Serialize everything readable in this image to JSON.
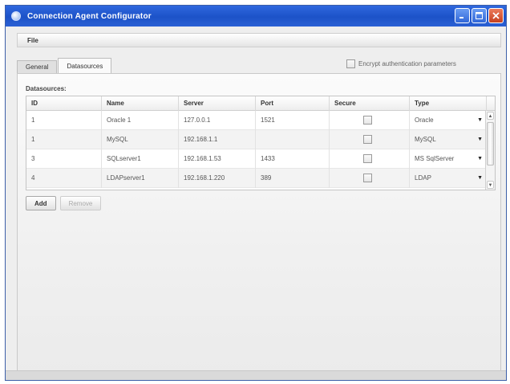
{
  "window": {
    "title": "Connection Agent Configurator"
  },
  "menu": {
    "items": [
      "File"
    ]
  },
  "tabs": [
    {
      "label": "General",
      "active": false
    },
    {
      "label": "Datasources",
      "active": true
    }
  ],
  "encrypt": {
    "label": "Encrypt authentication parameters",
    "checked": false
  },
  "datasources": {
    "section_label": "Datasources:",
    "columns": [
      "ID",
      "Name",
      "Server",
      "Port",
      "Secure",
      "Type"
    ],
    "rows": [
      {
        "id": "1",
        "name": "Oracle 1",
        "server": "127.0.0.1",
        "port": "1521",
        "secure": false,
        "type": "Oracle"
      },
      {
        "id": "1",
        "name": "MySQL",
        "server": "192.168.1.1",
        "port": "",
        "secure": false,
        "type": "MySQL"
      },
      {
        "id": "3",
        "name": "SQLserver1",
        "server": "192.168.1.53",
        "port": "1433",
        "secure": false,
        "type": "MS SqlServer"
      },
      {
        "id": "4",
        "name": "LDAPserver1",
        "server": "192.168.1.220",
        "port": "389",
        "secure": false,
        "type": "LDAP"
      }
    ]
  },
  "buttons": {
    "add": "Add",
    "remove": "Remove"
  },
  "colors": {
    "titlebar": "#1c52c8",
    "close_button": "#c5401f"
  }
}
